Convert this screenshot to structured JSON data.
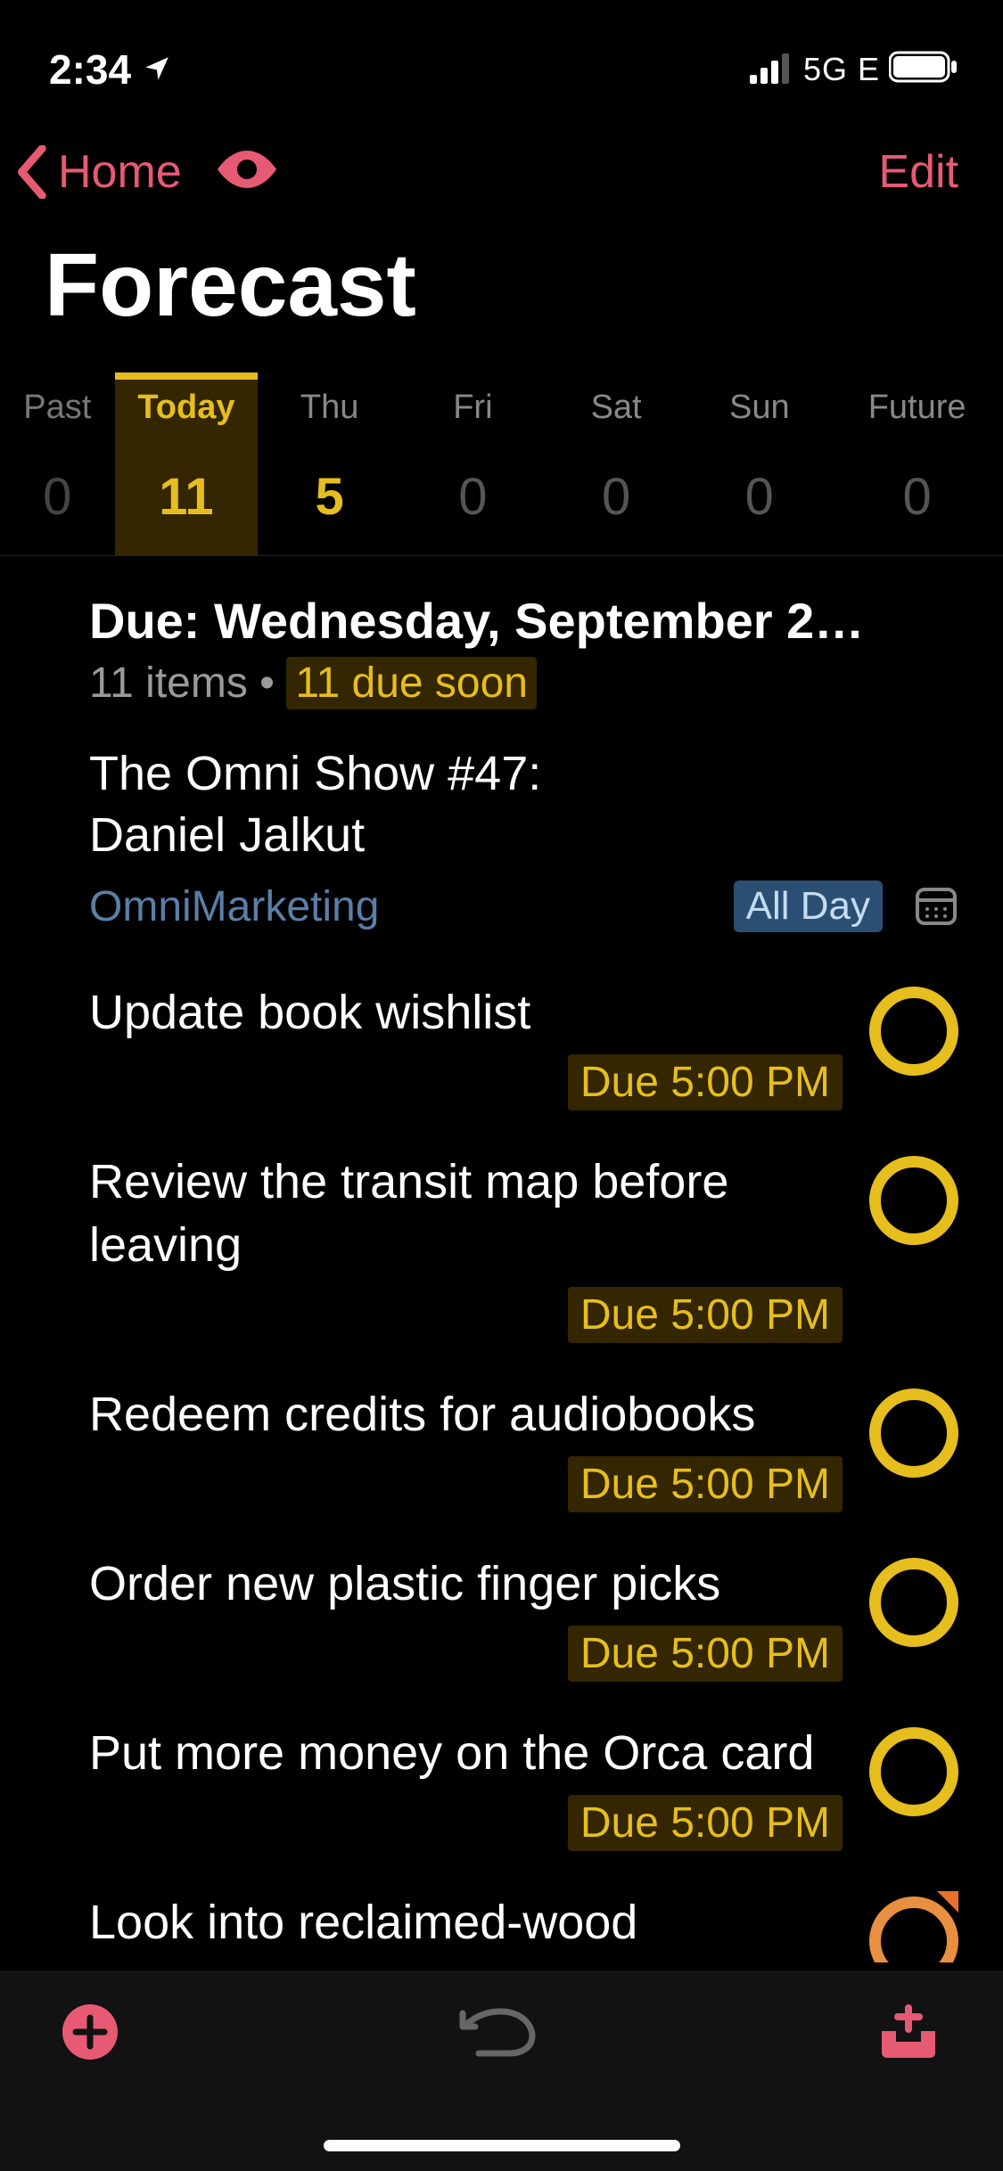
{
  "statusbar": {
    "time": "2:34",
    "network": "5G E"
  },
  "nav": {
    "back_label": "Home",
    "edit_label": "Edit"
  },
  "page_title": "Forecast",
  "forecast_columns": [
    {
      "label": "Past",
      "count": "0"
    },
    {
      "label": "Today",
      "count": "11"
    },
    {
      "label": "Thu",
      "count": "5"
    },
    {
      "label": "Fri",
      "count": "0"
    },
    {
      "label": "Sat",
      "count": "0"
    },
    {
      "label": "Sun",
      "count": "0"
    },
    {
      "label": "Future",
      "count": "0"
    }
  ],
  "section": {
    "title": "Due: Wednesday, September 2…",
    "items_count": "11 items",
    "bullet": " • ",
    "due_soon": "11 due soon"
  },
  "event": {
    "title_line1": "The Omni Show #47:",
    "title_line2": "Daniel Jalkut",
    "project": "OmniMarketing",
    "allday_label": "All Day"
  },
  "tasks": [
    {
      "title": "Update book wishlist",
      "due": "Due 5:00 PM",
      "flag": false
    },
    {
      "title": "Review the transit map before leaving",
      "due": "Due 5:00 PM",
      "flag": false
    },
    {
      "title": "Redeem credits for audiobooks",
      "due": "Due 5:00 PM",
      "flag": false
    },
    {
      "title": "Order new plastic finger picks",
      "due": "Due 5:00 PM",
      "flag": false
    },
    {
      "title": "Put more money on the Orca card",
      "due": "Due 5:00 PM",
      "flag": false
    },
    {
      "title": "Look into reclaimed-wood",
      "due": "",
      "flag": true
    }
  ]
}
